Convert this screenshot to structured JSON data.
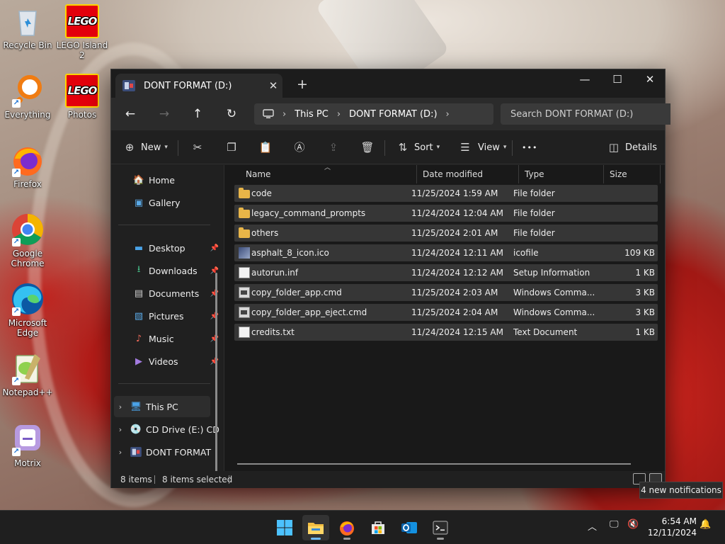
{
  "desktop": {
    "icons": [
      {
        "label": "Recycle Bin"
      },
      {
        "label": "LEGO Island 2",
        "logo_text": "LEGO"
      },
      {
        "label": "Everything"
      },
      {
        "label": "Photos",
        "logo_text": "LEGO"
      },
      {
        "label": "Firefox"
      },
      {
        "label": "Google Chrome"
      },
      {
        "label": "Microsoft Edge"
      },
      {
        "label": "Notepad++"
      },
      {
        "label": "Motrix"
      }
    ]
  },
  "window": {
    "tab_title": "DONT FORMAT (D:)",
    "new_tab": "+",
    "controls": {
      "minimize": "—",
      "maximize": "☐",
      "close": "✕"
    },
    "tab_close": "✕"
  },
  "address": {
    "crumbs": [
      "This PC",
      "DONT FORMAT (D:)"
    ],
    "search_placeholder": "Search DONT FORMAT (D:)"
  },
  "toolbar": {
    "new_label": "New",
    "sort_label": "Sort",
    "view_label": "View",
    "more_label": "•••",
    "details_label": "Details"
  },
  "navpane": {
    "quick": [
      {
        "label": "Home"
      },
      {
        "label": "Gallery"
      }
    ],
    "pinned": [
      {
        "label": "Desktop"
      },
      {
        "label": "Downloads"
      },
      {
        "label": "Documents"
      },
      {
        "label": "Pictures"
      },
      {
        "label": "Music"
      },
      {
        "label": "Videos"
      }
    ],
    "tree": [
      {
        "label": "This PC"
      },
      {
        "label": "CD Drive (E:) CD"
      },
      {
        "label": "DONT FORMAT"
      }
    ]
  },
  "columns": {
    "name": "Name",
    "date": "Date modified",
    "type": "Type",
    "size": "Size"
  },
  "files": [
    {
      "name": "code",
      "date": "11/25/2024 1:59 AM",
      "type": "File folder",
      "size": "",
      "icon": "folder-icon"
    },
    {
      "name": "legacy_command_prompts",
      "date": "11/24/2024 12:04 AM",
      "type": "File folder",
      "size": "",
      "icon": "folder-icon"
    },
    {
      "name": "others",
      "date": "11/25/2024 2:01 AM",
      "type": "File folder",
      "size": "",
      "icon": "folder-icon"
    },
    {
      "name": "asphalt_8_icon.ico",
      "date": "11/24/2024 12:11 AM",
      "type": "icofile",
      "size": "109 KB",
      "icon": "image-file-icon"
    },
    {
      "name": "autorun.inf",
      "date": "11/24/2024 12:12 AM",
      "type": "Setup Information",
      "size": "1 KB",
      "icon": "settings-file-icon"
    },
    {
      "name": "copy_folder_app.cmd",
      "date": "11/25/2024 2:03 AM",
      "type": "Windows Comma...",
      "size": "3 KB",
      "icon": "cmd-file-icon"
    },
    {
      "name": "copy_folder_app_eject.cmd",
      "date": "11/25/2024 2:04 AM",
      "type": "Windows Comma...",
      "size": "3 KB",
      "icon": "cmd-file-icon"
    },
    {
      "name": "credits.txt",
      "date": "11/24/2024 12:15 AM",
      "type": "Text Document",
      "size": "1 KB",
      "icon": "text-file-icon"
    }
  ],
  "status": {
    "items": "8 items",
    "selected": "8 items selected"
  },
  "notification": {
    "text": "4 new notifications"
  },
  "clock": {
    "time": "6:54 AM",
    "date": "12/11/2024"
  },
  "colors": {
    "folder": "#e8b548",
    "accent": "#6cb8f5",
    "window_bg": "#202020",
    "row_selected": "#363636"
  }
}
